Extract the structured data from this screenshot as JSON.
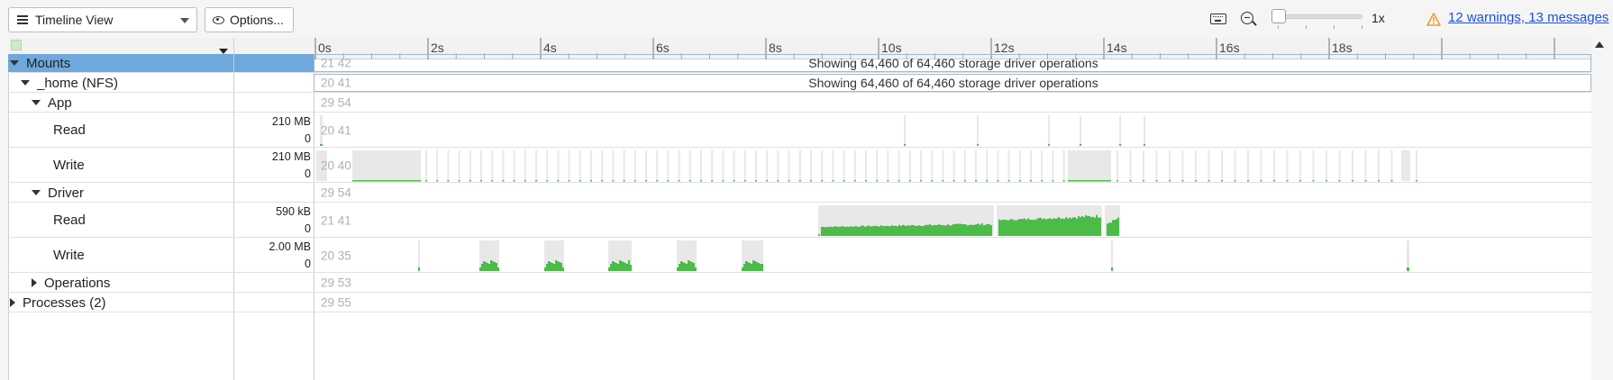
{
  "toolbar": {
    "view_selector": "Timeline View",
    "options_label": "Options...",
    "keyboard_icon": "keyboard-icon",
    "zoom_icon": "zoom-out-icon",
    "zoom_level": "1x",
    "warnings_link": "12 warnings, 13 messages"
  },
  "ruler": {
    "ticks": [
      "0s",
      "2s",
      "4s",
      "6s",
      "8s",
      "10s",
      "12s",
      "14s",
      "16s",
      "18s"
    ]
  },
  "rows": [
    {
      "label": "Mounts",
      "indent": 0,
      "expander": "down",
      "selected": true,
      "idx": "21 42",
      "message": "Showing 64,460 of 64,460 storage driver operations"
    },
    {
      "label": "_home (NFS)",
      "indent": 1,
      "expander": "down",
      "idx": "20 41",
      "message": "Showing 64,460 of 64,460 storage driver operations"
    },
    {
      "label": "App",
      "indent": 2,
      "expander": "down",
      "idx": "29 54"
    },
    {
      "label": "Read",
      "indent": 3,
      "idx": "20 41",
      "max": "210 MB",
      "min": "0",
      "track": "app-read"
    },
    {
      "label": "Write",
      "indent": 3,
      "idx": "20 40",
      "max": "210 MB",
      "min": "0",
      "track": "app-write"
    },
    {
      "label": "Driver",
      "indent": 2,
      "expander": "down",
      "idx": "29 54"
    },
    {
      "label": "Read",
      "indent": 3,
      "idx": "21 41",
      "max": "590 kB",
      "min": "0",
      "track": "driver-read"
    },
    {
      "label": "Write",
      "indent": 3,
      "idx": "20 35",
      "max": "2.00 MB",
      "min": "0",
      "track": "driver-write"
    },
    {
      "label": "Operations",
      "indent": 2,
      "expander": "right",
      "idx": "29 53"
    },
    {
      "label": "Processes (2)",
      "indent": 0,
      "expander": "right",
      "idx": "29 55"
    }
  ],
  "colors": {
    "selected_row": "#6fa8dc",
    "activity_bar": "#4cbb47",
    "activity_background": "#e8e8e8",
    "link": "#1a4fe0",
    "warning": "#f0a030"
  }
}
